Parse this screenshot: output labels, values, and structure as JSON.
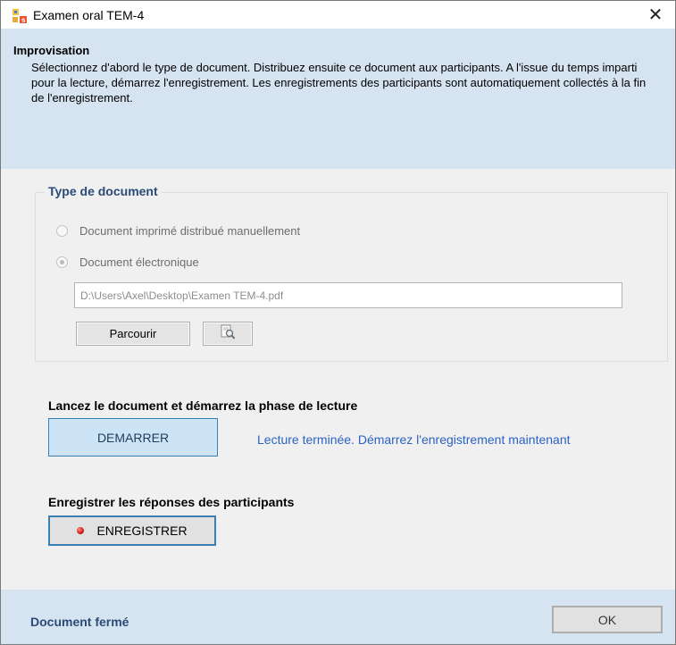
{
  "window": {
    "title": "Examen oral TEM-4",
    "icon": "app-icon",
    "close_label": "✕"
  },
  "header": {
    "title": "Improvisation",
    "description": "Sélectionnez d'abord le type de document. Distribuez ensuite ce document aux participants. A l'issue du temps imparti pour la lecture, démarrez l'enregistrement. Les enregistrements des participants sont automatiquement collectés à la fin de l'enregistrement."
  },
  "document_type": {
    "legend": "Type de document",
    "options": [
      {
        "label": "Document imprimé distribué manuellement",
        "checked": false
      },
      {
        "label": "Document électronique",
        "checked": true
      }
    ],
    "path_value": "D:\\Users\\Axel\\Desktop\\Examen TEM-4.pdf",
    "browse_label": "Parcourir",
    "preview_icon": "magnifier-document-icon"
  },
  "reading": {
    "title": "Lancez le document et démarrez la phase de lecture",
    "start_label": "DEMARRER",
    "status_text": "Lecture terminée. Démarrez l'enregistrement maintenant"
  },
  "recording": {
    "title": "Enregistrer les réponses des participants",
    "record_label": "ENREGISTRER",
    "record_icon": "record-dot-icon"
  },
  "footer": {
    "status": "Document fermé",
    "ok_label": "OK"
  },
  "colors": {
    "panel_blue": "#d6e4f2",
    "accent_blue": "#3c7fb1",
    "link_blue": "#2b63c4",
    "heading_navy": "#2a4a78"
  }
}
